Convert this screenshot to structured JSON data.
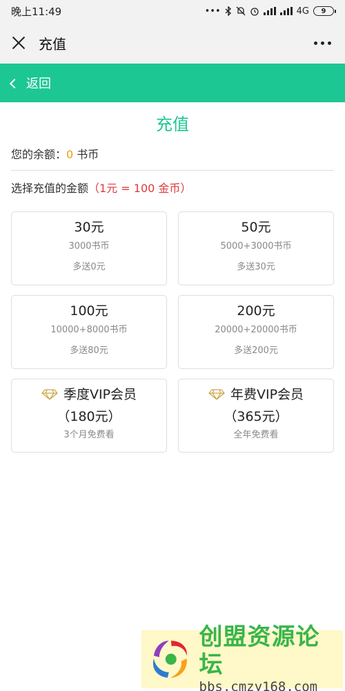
{
  "status_bar": {
    "time": "晚上11:49",
    "signal_text": "4G",
    "battery": "9"
  },
  "title_bar": {
    "title": "充值"
  },
  "header": {
    "back_label": "返回"
  },
  "main": {
    "title": "充值",
    "balance_prefix": "您的余额：",
    "balance_value": "0",
    "balance_unit": " 书币",
    "select_label": "选择充值的金额",
    "rate": "（1元 = 100 金币）",
    "packages": [
      {
        "amount": "30元",
        "coins": "3000书币",
        "bonus": "多送0元"
      },
      {
        "amount": "50元",
        "coins": "5000+3000书币",
        "bonus": "多送30元"
      },
      {
        "amount": "100元",
        "coins": "10000+8000书币",
        "bonus": "多送80元"
      },
      {
        "amount": "200元",
        "coins": "20000+20000书币",
        "bonus": "多送200元"
      }
    ],
    "vip": [
      {
        "title": "季度VIP会员",
        "price": "（180元）",
        "desc": "3个月免费看"
      },
      {
        "title": "年费VIP会员",
        "price": "（365元）",
        "desc": "全年免费看"
      }
    ]
  },
  "watermark": {
    "name": "创盟资源论坛",
    "url": "bbs.cmzy168.com"
  },
  "colors": {
    "accent": "#1dc794",
    "balance": "#e6a117",
    "rate": "#e03a3a"
  },
  "icons": [
    "close-icon",
    "more-icon",
    "back-chevron-icon",
    "diamond-icon"
  ]
}
